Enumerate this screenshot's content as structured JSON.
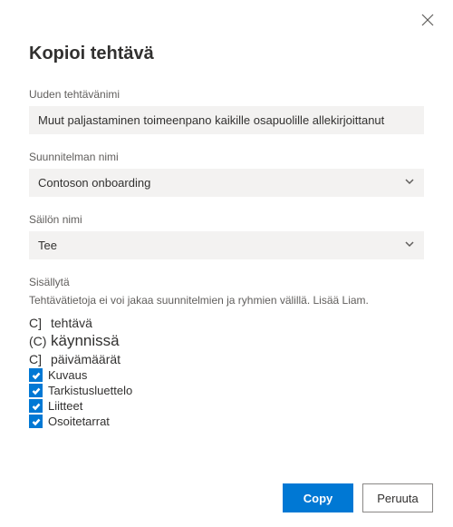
{
  "dialog": {
    "title": "Kopioi tehtävä",
    "close_icon": "close"
  },
  "taskName": {
    "label": "Uuden tehtävänimi",
    "value": "Muut paljastaminen toimeenpano kaikille osapuolille allekirjoittanut"
  },
  "planName": {
    "label": "Suunnitelman nimi",
    "value": "Contoson onboarding"
  },
  "bucketName": {
    "label": "Säilön nimi",
    "value": "Tee"
  },
  "include": {
    "label": "Sisällytä",
    "helper": "Tehtävätietoja ei voi jakaa suunnitelmien ja ryhmien välillä. Lisää Liam.",
    "items": [
      {
        "glyph": "C]",
        "label": "tehtävä",
        "kind": "glyph",
        "checked": false
      },
      {
        "glyph": "(C)",
        "label": "käynnissä",
        "kind": "glyph-big",
        "checked": false
      },
      {
        "glyph": "C]",
        "label": "päivämäärät",
        "kind": "glyph",
        "checked": false
      },
      {
        "label": "Kuvaus",
        "kind": "checkbox",
        "checked": true
      },
      {
        "label": "Tarkistusluettelo",
        "kind": "checkbox",
        "checked": true
      },
      {
        "label": "Liitteet",
        "kind": "checkbox-big",
        "checked": true
      },
      {
        "label": "Osoitetarrat",
        "kind": "checkbox",
        "checked": true
      }
    ]
  },
  "footer": {
    "primary": "Copy",
    "secondary": "Peruuta"
  }
}
